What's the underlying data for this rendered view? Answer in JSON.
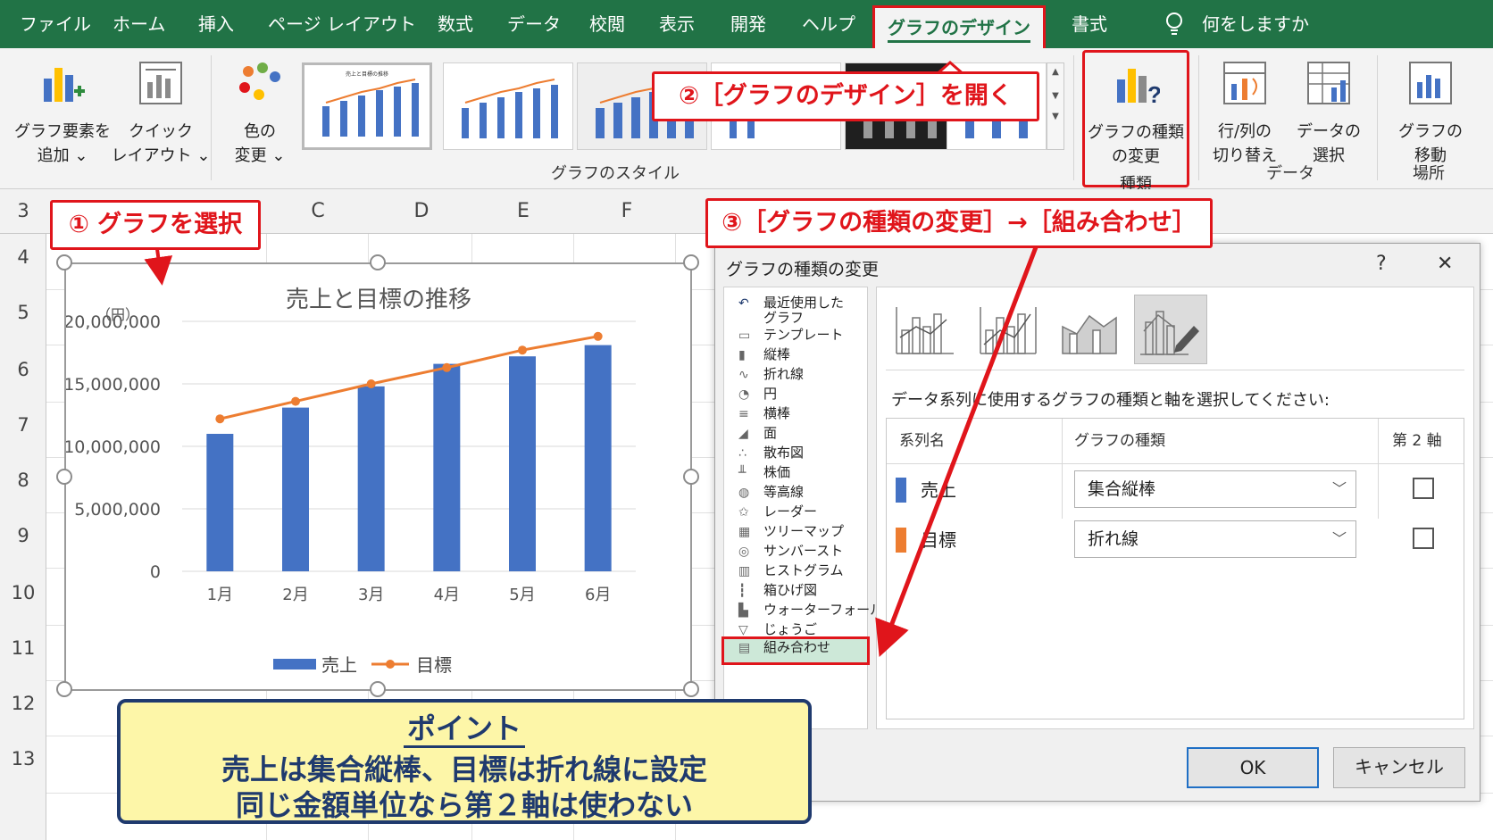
{
  "ribbon": {
    "tabs": [
      "ファイル",
      "ホーム",
      "挿入",
      "ページ レイアウト",
      "数式",
      "データ",
      "校閲",
      "表示",
      "開発",
      "ヘルプ",
      "グラフのデザイン",
      "書式"
    ],
    "active_tab": "グラフのデザイン",
    "tell_me": "何をしますか",
    "buttons": {
      "add_element": [
        "グラフ要素を",
        "追加 ⌄"
      ],
      "quick_layout": [
        "クイック",
        "レイアウト ⌄"
      ],
      "change_colors": [
        "色の",
        "変更 ⌄"
      ],
      "change_type": [
        "グラフの種類",
        "の変更"
      ],
      "switch_row_col": [
        "行/列の",
        "切り替え"
      ],
      "select_data": [
        "データの",
        "選択"
      ],
      "move_chart": [
        "グラフの",
        "移動"
      ]
    },
    "groups": {
      "styles": "グラフのスタイル",
      "type": "種類",
      "data": "データ",
      "location": "場所"
    },
    "style_thumb_title": "売上と目標の推移"
  },
  "sheet": {
    "columns": [
      "C",
      "D",
      "E",
      "F"
    ],
    "rows": [
      "3",
      "4",
      "5",
      "6",
      "7",
      "8",
      "9",
      "10",
      "11",
      "12",
      "13"
    ]
  },
  "chart_data": {
    "type": "bar",
    "title": "売上と目標の推移",
    "ylabel": "（円）",
    "categories": [
      "1月",
      "2月",
      "3月",
      "4月",
      "5月",
      "6月"
    ],
    "ylim": [
      0,
      20000000
    ],
    "yticks": [
      "20,000,000",
      "15,000,000",
      "10,000,000",
      "5,000,000",
      "0"
    ],
    "legend_position": "bottom",
    "series": [
      {
        "name": "売上",
        "kind": "bar",
        "color": "#4472c4",
        "values": [
          11000000,
          13100000,
          14800000,
          16600000,
          17200000,
          18100000
        ]
      },
      {
        "name": "目標",
        "kind": "line",
        "color": "#ed7d31",
        "values": [
          12200000,
          13600000,
          15000000,
          16300000,
          17700000,
          18800000
        ]
      }
    ]
  },
  "callouts": {
    "step1": "① グラフを選択",
    "step2": "②［グラフのデザイン］を開く",
    "step3": "③［グラフの種類の変更］→［組み合わせ］"
  },
  "dialog": {
    "title": "グラフの種類の変更",
    "help": "?",
    "close": "✕",
    "categories": [
      "最近使用した",
      "テンプレート",
      "縦棒",
      "折れ線",
      "円",
      "横棒",
      "面",
      "散布図",
      "株価",
      "等高線",
      "レーダー",
      "ツリーマップ",
      "サンバースト",
      "ヒストグラム",
      "箱ひげ図",
      "ウォーターフォール",
      "じょうご",
      "組み合わせ"
    ],
    "recent_second_line": "グラフ",
    "selected_category": "組み合わせ",
    "instruction": "データ系列に使用するグラフの種類と軸を選択してください:",
    "table_headers": {
      "series": "系列名",
      "type": "グラフの種類",
      "axis": "第 2 軸"
    },
    "rows": [
      {
        "name": "売上",
        "type": "集合縦棒",
        "color": "#4472c4",
        "secondary": false
      },
      {
        "name": "目標",
        "type": "折れ線",
        "color": "#ed7d31",
        "secondary": false
      }
    ],
    "ok": "OK",
    "cancel": "キャンセル"
  },
  "point": {
    "title": "ポイント",
    "line1": "売上は集合縦棒、目標は折れ線に設定",
    "line2": "同じ金額単位なら第２軸は使わない"
  },
  "colors": {
    "excel_green": "#217346",
    "callout_red": "#e0151b",
    "point_bg": "#fdf6a8",
    "point_border": "#1f3a6e"
  }
}
